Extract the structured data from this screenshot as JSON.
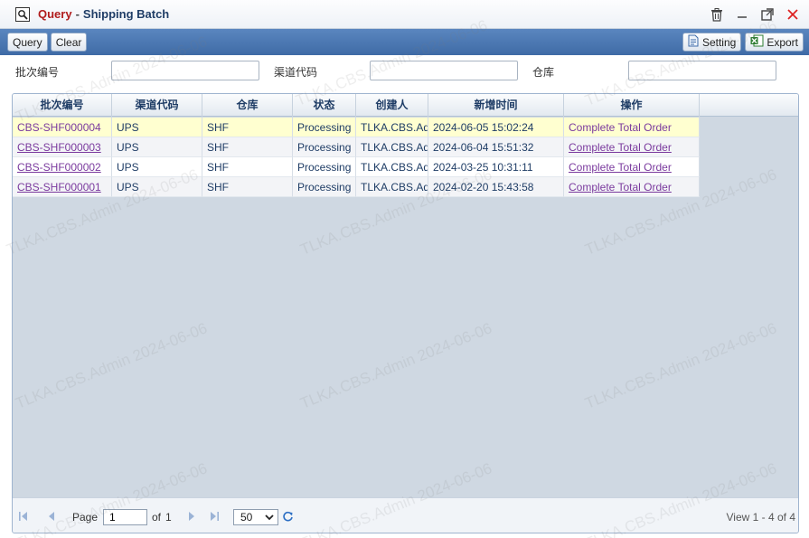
{
  "window": {
    "title_query": "Query",
    "title_separator": "-",
    "title_name": "Shipping Batch"
  },
  "toolbar": {
    "query_label": "Query",
    "clear_label": "Clear",
    "setting_label": "Setting",
    "export_label": "Export"
  },
  "filters": {
    "batch_no_label": "批次编号",
    "channel_code_label": "渠道代码",
    "warehouse_label": "仓库",
    "batch_no_value": "",
    "channel_code_value": "",
    "warehouse_value": ""
  },
  "grid": {
    "columns": [
      "批次编号",
      "渠道代码",
      "仓库",
      "状态",
      "创建人",
      "新增时间",
      "操作"
    ],
    "rows": [
      {
        "batch_no": "CBS-SHF000004",
        "channel": "UPS",
        "warehouse": "SHF",
        "status": "Processing",
        "creator": "TLKA.CBS.Admin",
        "created": "2024-06-05 15:02:24",
        "action": "Complete Total Order"
      },
      {
        "batch_no": "CBS-SHF000003",
        "channel": "UPS",
        "warehouse": "SHF",
        "status": "Processing",
        "creator": "TLKA.CBS.Admin",
        "created": "2024-06-04 15:51:32",
        "action": "Complete Total Order"
      },
      {
        "batch_no": "CBS-SHF000002",
        "channel": "UPS",
        "warehouse": "SHF",
        "status": "Processing",
        "creator": "TLKA.CBS.Admin",
        "created": "2024-03-25 10:31:11",
        "action": "Complete Total Order"
      },
      {
        "batch_no": "CBS-SHF000001",
        "channel": "UPS",
        "warehouse": "SHF",
        "status": "Processing",
        "creator": "TLKA.CBS.Admin",
        "created": "2024-02-20 15:43:58",
        "action": "Complete Total Order"
      }
    ]
  },
  "pager": {
    "page_label": "Page",
    "page_value": "1",
    "of_label": "of",
    "total_pages": "1",
    "page_size": "50",
    "view_text": "View 1 - 4 of 4"
  },
  "watermark": {
    "text": "TLKA.CBS.Admin 2024-06-06"
  },
  "colors": {
    "toolbar": "#4a77b4",
    "title_query": "#b01c1c",
    "header_text": "#1f3d66",
    "link": "#7a3a9e",
    "row_highlight": "#ffffd0",
    "row_alt": "#f3f4f7",
    "grid_background": "#cfd8e2"
  },
  "icons": {
    "app": "search-window-icon",
    "delete": "trash-icon",
    "minimize": "minimize-icon",
    "maximize": "maximize-icon",
    "close": "close-icon",
    "setting": "setting-document-icon",
    "export": "excel-export-icon",
    "first": "first-page-icon",
    "prev": "prev-page-icon",
    "next": "next-page-icon",
    "last": "last-page-icon",
    "refresh": "refresh-icon"
  }
}
